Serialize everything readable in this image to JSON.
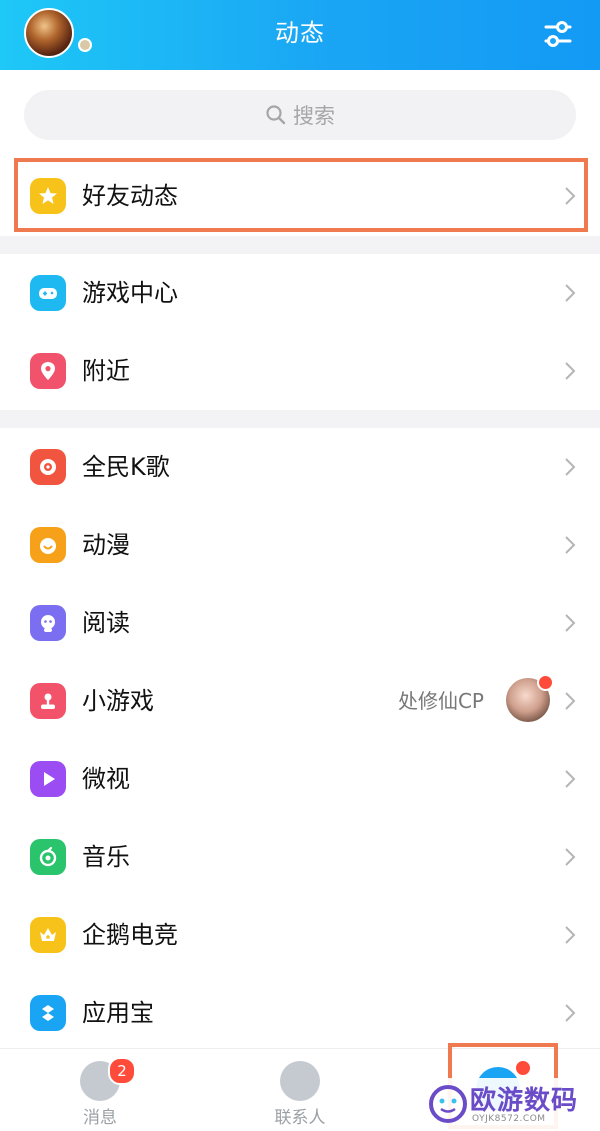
{
  "header": {
    "title": "动态",
    "avatar_icon": "user-avatar",
    "settings_icon": "sliders-icon"
  },
  "search": {
    "placeholder": "搜索",
    "icon": "search-icon"
  },
  "friends_feed": {
    "label": "好友动态",
    "icon": "star-badge-icon",
    "icon_color": "#f7c21a",
    "highlight_color": "#f07a4f"
  },
  "section1": [
    {
      "label": "游戏中心",
      "icon": "gamepad-icon",
      "color": "#1fb9f2"
    },
    {
      "label": "附近",
      "icon": "location-pin-icon",
      "color": "#f0536b"
    }
  ],
  "section2": [
    {
      "label": "全民K歌",
      "icon": "karaoke-icon",
      "color": "#f2553f"
    },
    {
      "label": "动漫",
      "icon": "anime-face-icon",
      "color": "#f7a11a"
    },
    {
      "label": "阅读",
      "icon": "reader-icon",
      "color": "#7b6ef0"
    },
    {
      "label": "小游戏",
      "icon": "joystick-icon",
      "color": "#f2536b",
      "extra_text": "处修仙CP"
    },
    {
      "label": "微视",
      "icon": "play-icon",
      "color": "#9b4cf2"
    },
    {
      "label": "音乐",
      "icon": "music-note-icon",
      "color": "#29c46c"
    },
    {
      "label": "企鹅电竞",
      "icon": "crown-icon",
      "color": "#f7c21a"
    },
    {
      "label": "应用宝",
      "icon": "app-store-icon",
      "color": "#1aa5f4"
    }
  ],
  "tabbar": {
    "messages": {
      "label": "消息",
      "badge": "2",
      "icon": "chat-face-icon"
    },
    "contacts": {
      "label": "联系人",
      "icon": "person-icon"
    },
    "dynamic": {
      "icon": "planet-icon"
    }
  },
  "watermark": {
    "text": "欧游数码",
    "url": "OYJK8572.COM"
  }
}
